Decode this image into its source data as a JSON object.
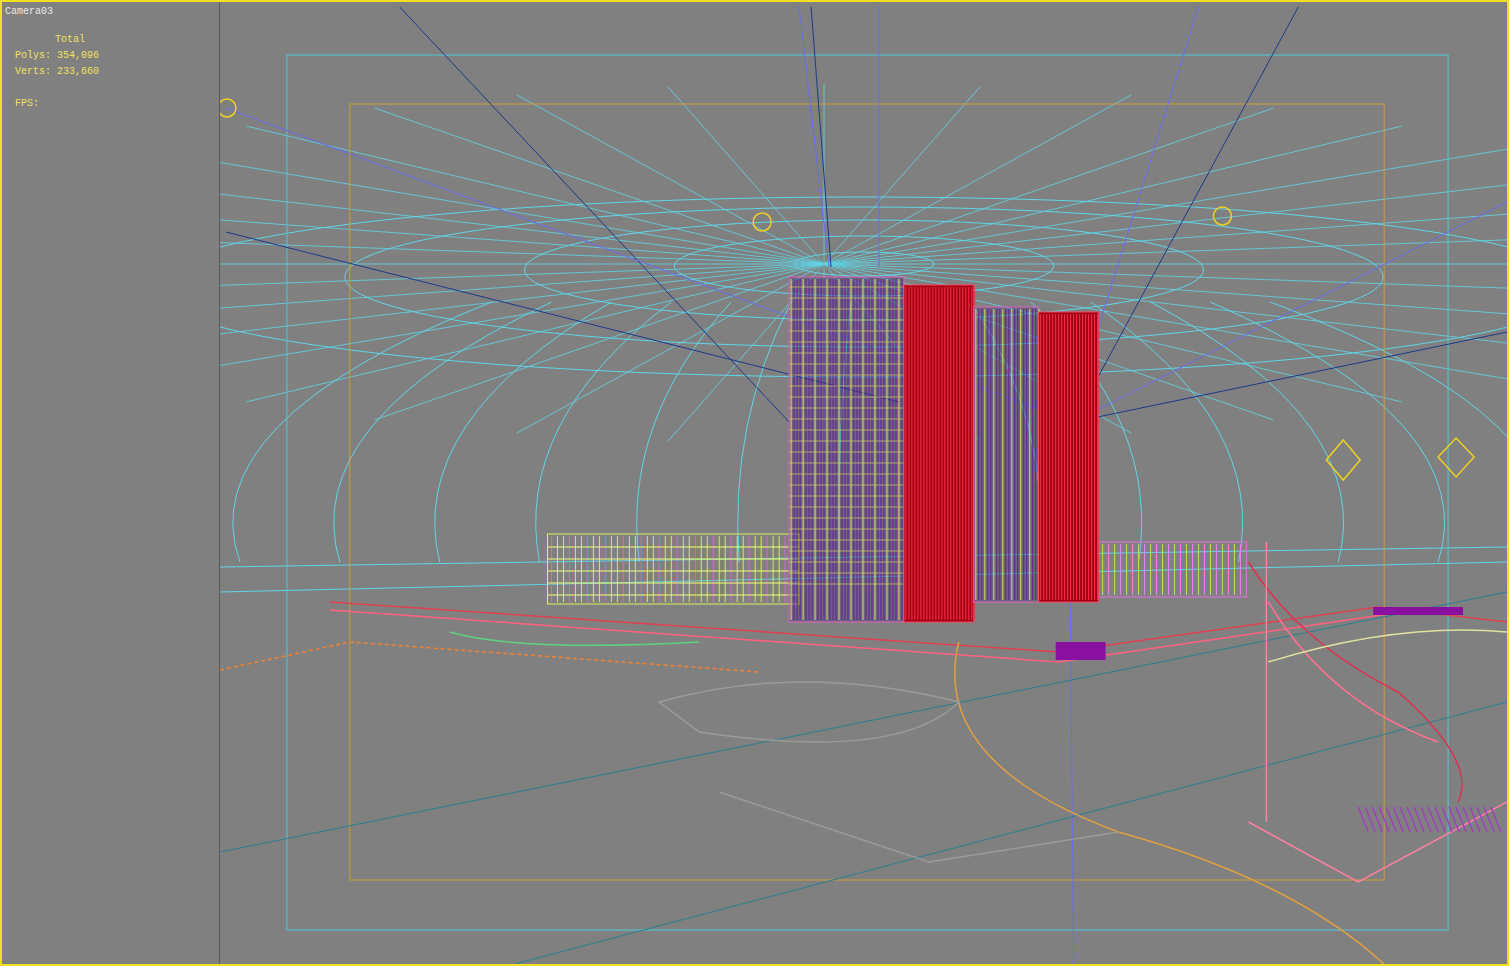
{
  "viewport": {
    "label": "Camera03",
    "active": true
  },
  "stats": {
    "heading": "Total",
    "lines": [
      "Polys: 354,096",
      "Verts: 233,660",
      "FPS:"
    ]
  }
}
